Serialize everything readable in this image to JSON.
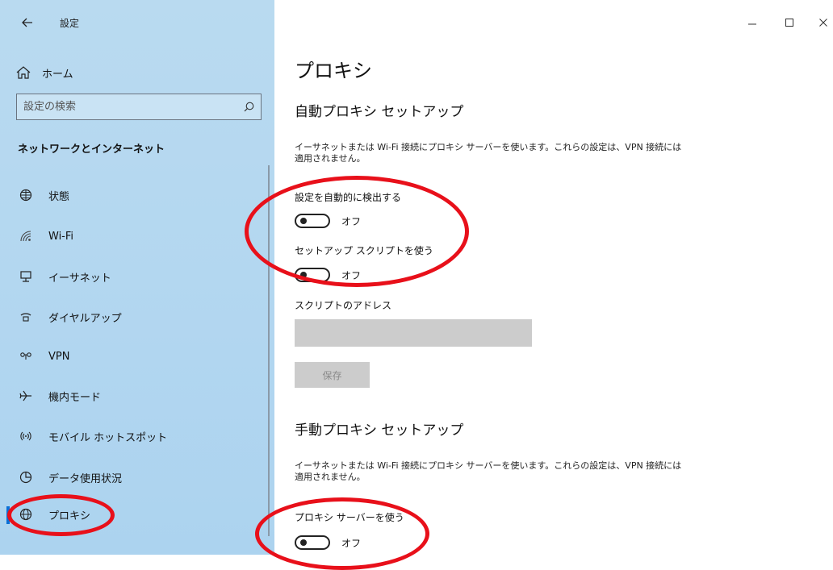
{
  "app": {
    "title": "設定"
  },
  "sidebar": {
    "home_label": "ホーム",
    "search_placeholder": "設定の検索",
    "section_title": "ネットワークとインターネット",
    "items": [
      {
        "label": "状態",
        "icon": "status-globe-icon"
      },
      {
        "label": "Wi-Fi",
        "icon": "wifi-icon"
      },
      {
        "label": "イーサネット",
        "icon": "ethernet-icon"
      },
      {
        "label": "ダイヤルアップ",
        "icon": "dialup-icon"
      },
      {
        "label": "VPN",
        "icon": "vpn-icon"
      },
      {
        "label": "機内モード",
        "icon": "airplane-icon"
      },
      {
        "label": "モバイル ホットスポット",
        "icon": "hotspot-icon"
      },
      {
        "label": "データ使用状況",
        "icon": "data-usage-icon"
      },
      {
        "label": "プロキシ",
        "icon": "globe-icon",
        "selected": true
      }
    ]
  },
  "main": {
    "title": "プロキシ",
    "auto": {
      "heading": "自動プロキシ セットアップ",
      "description": "イーサネットまたは Wi-Fi 接続にプロキシ サーバーを使います。これらの設定は、VPN 接続には適用されません。",
      "detect_label": "設定を自動的に検出する",
      "detect_state": "オフ",
      "script_label": "セットアップ スクリプトを使う",
      "script_state": "オフ",
      "address_label": "スクリプトのアドレス",
      "address_value": "",
      "save_label": "保存"
    },
    "manual": {
      "heading": "手動プロキシ セットアップ",
      "description": "イーサネットまたは Wi-Fi 接続にプロキシ サーバーを使います。これらの設定は、VPN 接続には適用されません。",
      "use_label": "プロキシ サーバーを使う",
      "use_state": "オフ"
    }
  },
  "colors": {
    "sidebar_bg": "#b3d7f0",
    "accent": "#0a6fd6",
    "annotation": "#e8101a",
    "disabled": "#cccccc"
  }
}
